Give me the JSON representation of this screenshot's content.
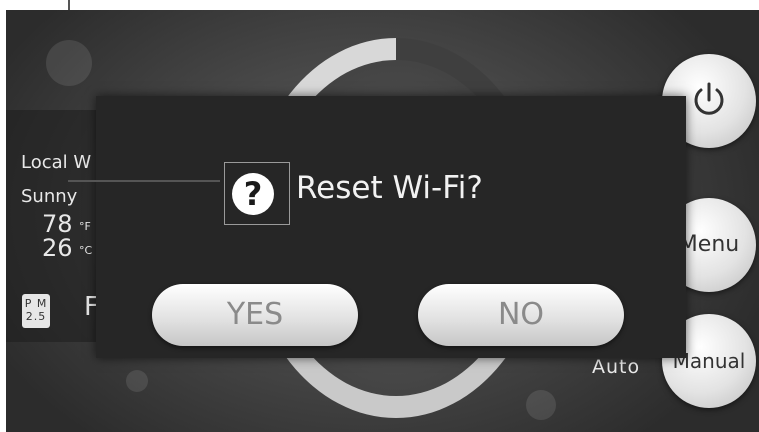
{
  "weather_panel": {
    "location_label": "Local W",
    "condition": "Sunny",
    "temp_f": "78",
    "unit_f": "°F",
    "temp_c": "26",
    "unit_c": "°C",
    "pm_badge_top": "P M",
    "pm_badge_bottom": "2.5",
    "pm_value_partial": "F"
  },
  "side_buttons": {
    "power_icon": "power-icon",
    "menu_label": "Menu",
    "manual_label": "Manual",
    "mode_label": "Auto"
  },
  "dialog": {
    "icon": "question-icon",
    "title": "Reset Wi-Fi?",
    "yes_label": "YES",
    "no_label": "NO"
  },
  "colors": {
    "dialog_bg": "#262626",
    "button_text": "#8a8a8a",
    "screen_bg": "#4a4a4a"
  }
}
